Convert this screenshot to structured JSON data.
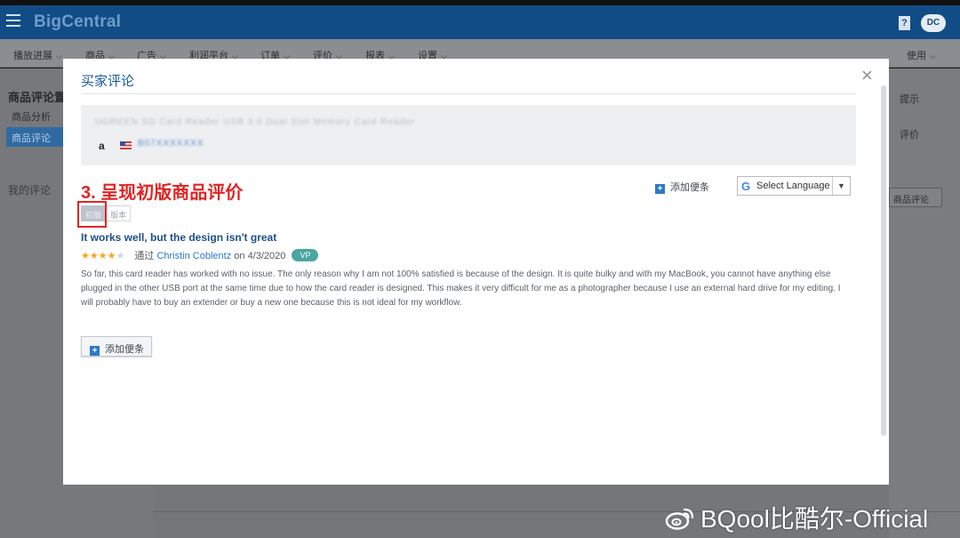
{
  "app": {
    "logo": "BigCentral",
    "help_label": "?",
    "user_initials": "DC"
  },
  "nav": {
    "items": [
      "播放进展",
      "商品",
      "广告",
      "利润平台",
      "订单",
      "评价",
      "报表",
      "设置"
    ],
    "right_item": "使用"
  },
  "left_panel": {
    "title": "商品评论置",
    "link": "商品分析",
    "active_item": "商品评论",
    "section2": "我的评论"
  },
  "right_panel": {
    "button": "提示",
    "text": "评价",
    "select": "商品评论"
  },
  "modal": {
    "title": "买家评论",
    "close_glyph": "×",
    "product": {
      "title_blurred": "UGREEN SD Card Reader USB 3.0 Dual Slot Memory Card Reader",
      "marketplace": "a",
      "asin_blurred": "B07XXXXXXX"
    },
    "annotation": "3. 呈现初版商品评价",
    "add_note_label": "添加便条",
    "language_select": "Select Language",
    "tags": [
      "初版",
      "版本"
    ],
    "review": {
      "title": "It works well, but the design isn't great",
      "rating": 4,
      "rating_max": 5,
      "by_label": "通过",
      "author": "Christin Coblentz",
      "date_text": "on 4/3/2020",
      "badge": "VP",
      "body": "So far, this card reader has worked with no issue. The only reason why I am not 100% satisfied is because of the design. It is quite bulky and with my MacBook, you cannot have anything else plugged in the other USB port at the same time due to how the card reader is designed. This makes it very difficult for me as a photographer because I use an external hard drive for my editing. I will probably have to buy an extender or buy a new one because this is not ideal for my workflow."
    },
    "add_note_button": "添加便条"
  },
  "watermark": "BQool比酷尔-Official",
  "colors": {
    "brand_blue": "#114c87",
    "annotation_red": "#e02424",
    "star": "#f5a524",
    "vp_badge": "#4aa6a0",
    "link": "#2d78c8"
  }
}
